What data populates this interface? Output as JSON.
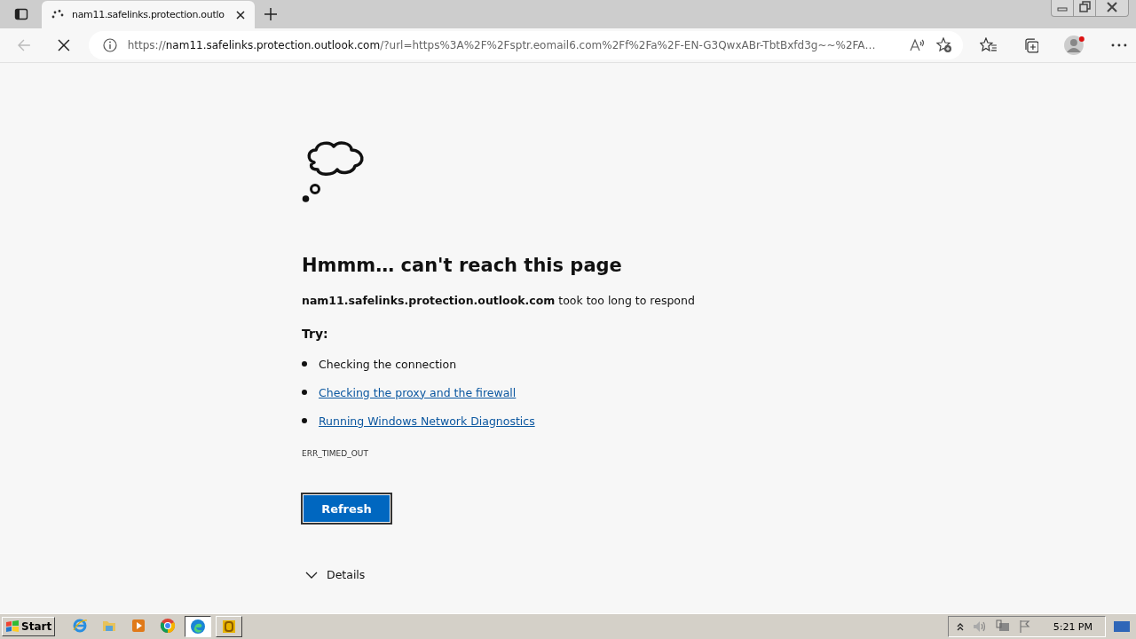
{
  "tab": {
    "title": "nam11.safelinks.protection.outlo",
    "loading": true
  },
  "address": {
    "scheme": "https://",
    "host": "nam11.safelinks.protection.outlook.com",
    "rest": "/?url=https%3A%2F%2Fsptr.eomail6.com%2Ff%2Fa%2F-EN-G3QwxABr-TbtBxfd3g~~%2FA…"
  },
  "error": {
    "heading": "Hmmm… can't reach this page",
    "host": "nam11.safelinks.protection.outlook.com",
    "message": "took too long to respond",
    "try_label": "Try:",
    "suggestions": [
      {
        "kind": "text",
        "text": "Checking the connection"
      },
      {
        "kind": "link",
        "text": "Checking the proxy and the firewall"
      },
      {
        "kind": "link",
        "text": "Running Windows Network Diagnostics"
      }
    ],
    "code": "ERR_TIMED_OUT",
    "button": "Refresh",
    "details": "Details"
  },
  "taskbar": {
    "start": "Start",
    "apps": [
      {
        "kind": "ie",
        "selected": false
      },
      {
        "kind": "folder",
        "selected": false
      },
      {
        "kind": "media",
        "selected": false
      },
      {
        "kind": "chrome",
        "selected": false
      },
      {
        "kind": "edge",
        "selected": true
      },
      {
        "kind": "outlook",
        "selected": false
      }
    ],
    "time": "5:21 PM"
  }
}
